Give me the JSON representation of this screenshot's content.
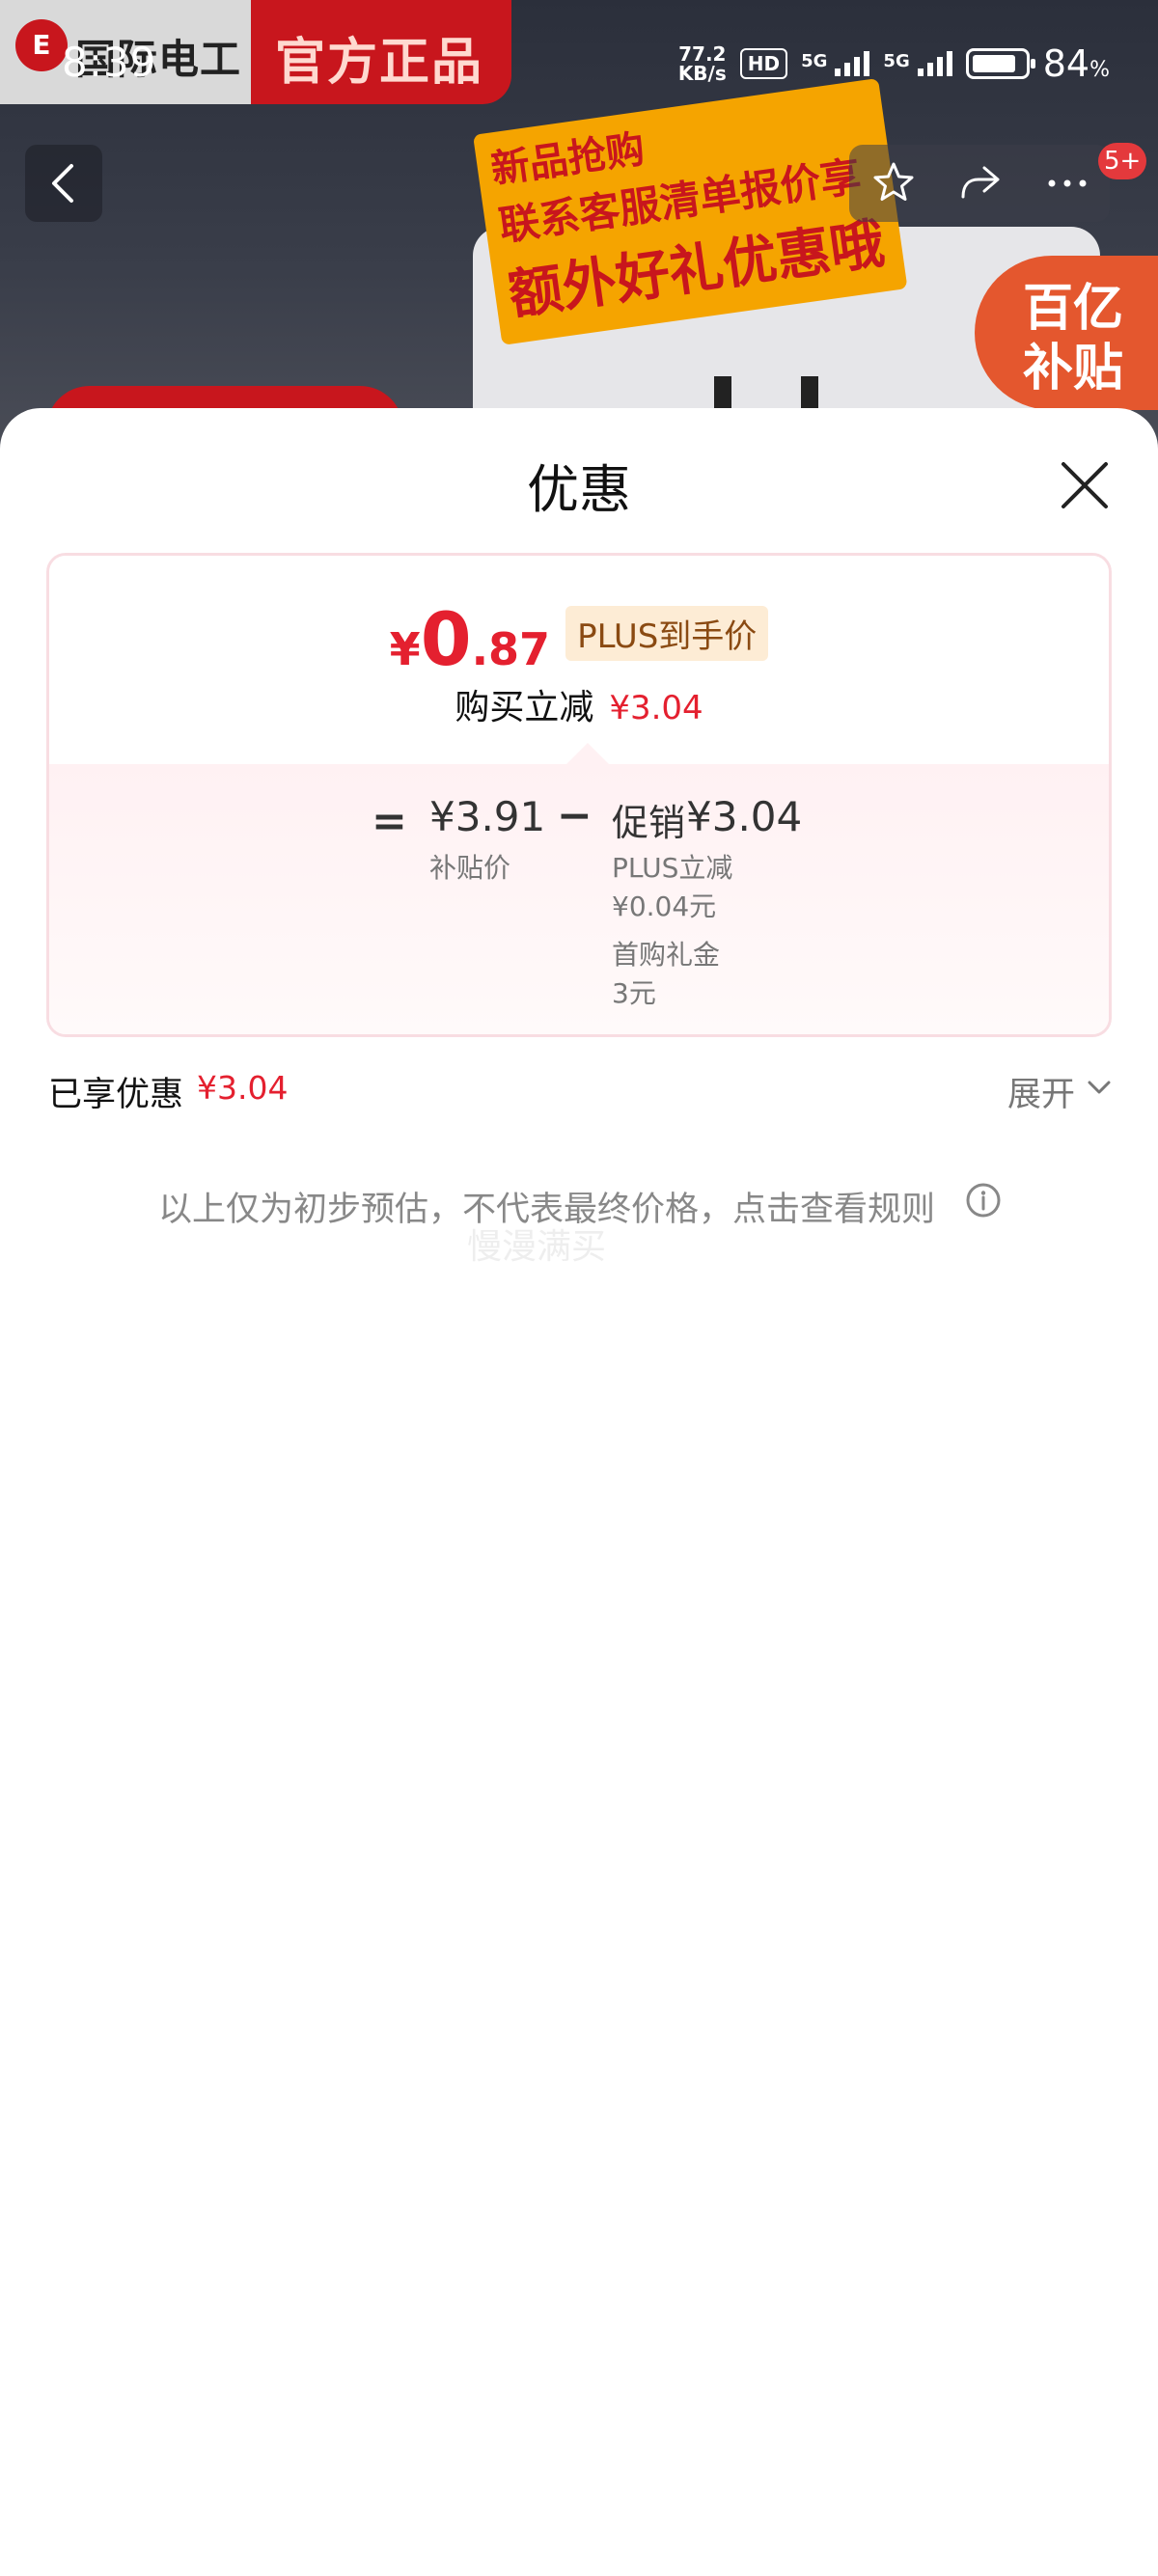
{
  "background": {
    "brand_logo": "E",
    "brand_name": "国际电工",
    "brand_tag": "官方正品",
    "promo_line1": "新品抢购",
    "promo_line2": "联系客服清单报价享",
    "promo_line3": "额外好礼优惠哦",
    "subsidy_line1": "百亿",
    "subsidy_line2": "补贴",
    "nav_badge": "5+"
  },
  "status_bar": {
    "time": "8:39",
    "speed_value": "77.2",
    "speed_unit": "KB/s",
    "hd_label": "HD",
    "net1": "5G",
    "net2": "5G",
    "battery_percent": "84",
    "battery_unit": "%"
  },
  "sheet": {
    "title": "优惠",
    "price": {
      "currency": "¥",
      "integer": "0",
      "decimal": ".87",
      "tag": "PLUS到手价"
    },
    "reduce_label": "购买立减",
    "reduce_amount": "¥3.04",
    "breakdown": {
      "equals": "=",
      "subsidy_price": "¥3.91",
      "subsidy_label": "补贴价",
      "minus": "−",
      "promo_label": "促销",
      "promo_amount": "¥3.04",
      "detail1_label": "PLUS立减",
      "detail1_value": "¥0.04元",
      "detail2_label": "首购礼金",
      "detail2_value": "3元"
    },
    "enjoyed_label": "已享优惠",
    "enjoyed_amount": "¥3.04",
    "expand_label": "展开",
    "note": "以上仅为初步预估，不代表最终价格，点击查看规则",
    "watermark": "慢漫满买"
  },
  "icons": {
    "back": "chevron-left-icon",
    "favorite": "star-icon",
    "share": "share-icon",
    "more": "more-icon",
    "close": "close-icon",
    "expand": "chevron-down-icon",
    "info": "info-icon"
  },
  "colors": {
    "accent_red": "#e4202f",
    "plus_tag_bg": "#fdecd5",
    "plus_tag_text": "#8a4a12",
    "card_border": "#f8dde2"
  }
}
